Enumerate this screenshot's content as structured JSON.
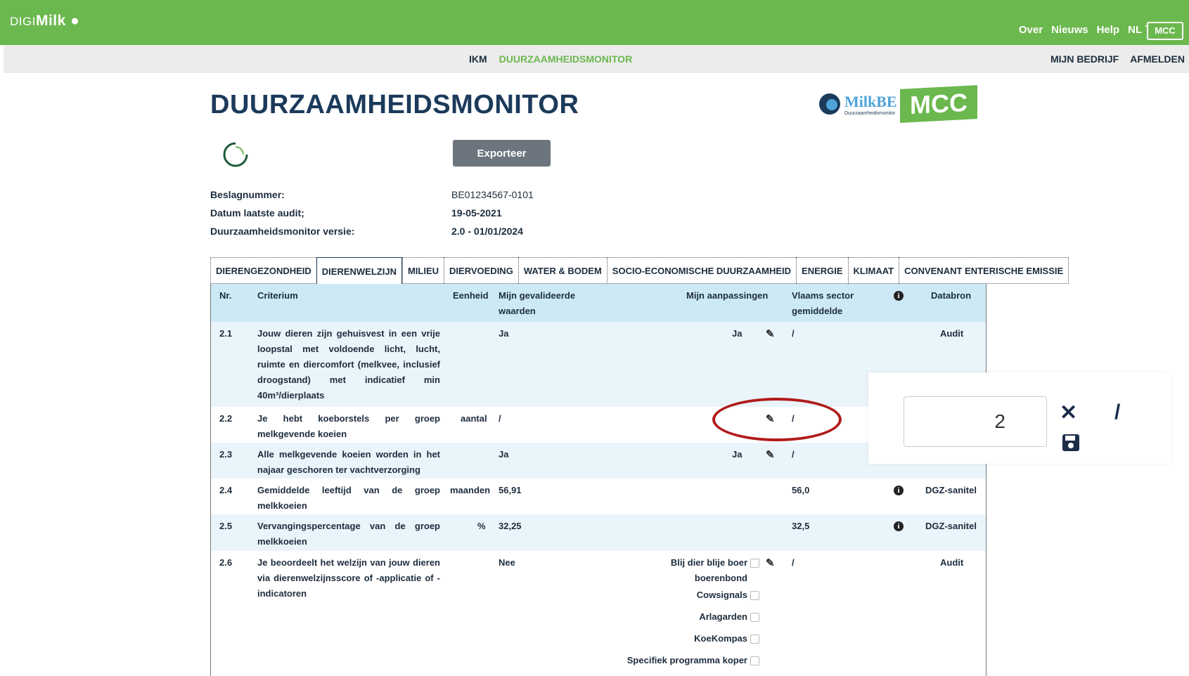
{
  "topbar": {
    "logo_prefix": "DIGI",
    "logo_main": "Milk",
    "nav": [
      "Over",
      "Nieuws",
      "Help",
      "NL ˇ"
    ],
    "mcc": "MCC"
  },
  "subnav": {
    "items": [
      "IKM",
      "DUURZAAMHEIDSMONITOR"
    ],
    "right": [
      "MIJN BEDRIJF",
      "AFMELDEN"
    ]
  },
  "page": {
    "title": "DUURZAAMHEIDSMONITOR",
    "milkbe": "MilkBE",
    "milkbe_sub": "Duurzaamheidsmonitor",
    "mcc_logo": "MCC",
    "export_label": "Exporteer"
  },
  "info": {
    "beslag_label": "Beslagnummer:",
    "beslag_value": "BE01234567-0101",
    "audit_label": "Datum laatste audit;",
    "audit_value": "19-05-2021",
    "versie_label": "Duurzaamheidsmonitor versie:",
    "versie_value": "2.0 - 01/01/2024"
  },
  "tabs": [
    "DIERENGEZONDHEID",
    "DIERENWELZIJN",
    "MILIEU",
    "DIERVOEDING",
    "WATER & BODEM",
    "SOCIO-ECONOMISCHE DUURZAAMHEID",
    "ENERGIE",
    "KLIMAAT",
    "CONVENANT ENTERISCHE EMISSIE"
  ],
  "table": {
    "headers": {
      "nr": "Nr.",
      "criterium": "Criterium",
      "eenheid": "Eenheid",
      "mijn_line1": "Mijn gevalideerde",
      "mijn_line2": "waarden",
      "aanpassingen": "Mijn aanpassingen",
      "sector_line1": "Vlaams sector",
      "sector_line2": "gemiddelde",
      "databron": "Databron"
    },
    "rows": [
      {
        "nr": "2.1",
        "criterium": "Jouw dieren zijn gehuisvest in een vrije loopstal met voldoende licht, lucht, ruimte en diercomfort (melkvee, inclusief droogstand) met indicatief min 40m³/dierplaats",
        "eenheid": "",
        "waarde": "Ja",
        "aanpassing": "Ja",
        "sector": "/",
        "databron": "Audit"
      },
      {
        "nr": "2.2",
        "criterium": "Je hebt koeborstels per groep melkgevende koeien",
        "eenheid": "aantal",
        "waarde": "/",
        "aanpassing": "",
        "sector": "/",
        "databron": ""
      },
      {
        "nr": "2.3",
        "criterium": "Alle melkgevende koeien worden in het najaar geschoren ter vachtverzorging",
        "eenheid": "",
        "waarde": "Ja",
        "aanpassing": "Ja",
        "sector": "/",
        "databron": ""
      },
      {
        "nr": "2.4",
        "criterium": "Gemiddelde leeftijd van de groep melkkoeien",
        "eenheid": "maanden",
        "waarde": "56,91",
        "aanpassing": "",
        "sector": "56,0",
        "databron": "DGZ-sanitel"
      },
      {
        "nr": "2.5",
        "criterium": "Vervangingspercentage van de groep melkkoeien",
        "eenheid": "%",
        "waarde": "32,25",
        "aanpassing": "",
        "sector": "32,5",
        "databron": "DGZ-sanitel"
      },
      {
        "nr": "2.6",
        "criterium": "Je beoordeelt het welzijn van jouw dieren via dierenwelzijnsscore of -applicatie of -indicatoren",
        "eenheid": "",
        "waarde": "Nee",
        "aanpassing": "",
        "sector": "/",
        "databron": "Audit"
      }
    ],
    "options_26": [
      "Blij dier blije boer",
      "boerenbond",
      "Cowsignals",
      "Arlagarden",
      "KoeKompas",
      "Specifiek programma koper"
    ]
  },
  "popover": {
    "value": "2",
    "slash": "/"
  }
}
